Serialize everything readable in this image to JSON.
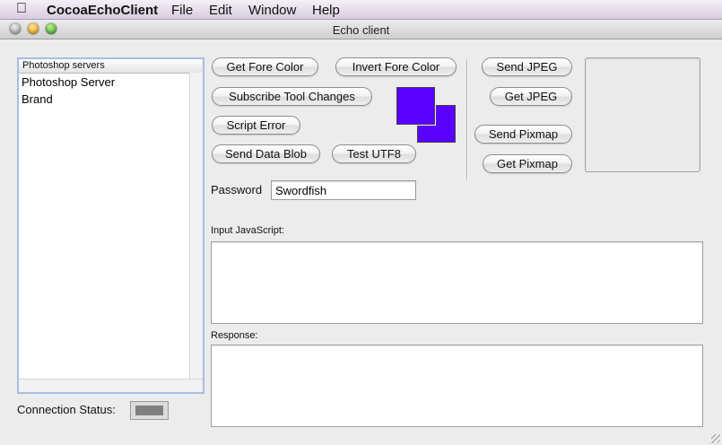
{
  "menubar": {
    "app_name": "CocoaEchoClient",
    "items": [
      "File",
      "Edit",
      "Window",
      "Help"
    ]
  },
  "window": {
    "title": "Echo client"
  },
  "server_list": {
    "header": "Photoshop servers",
    "rows": [
      "Photoshop Server",
      "Brand"
    ]
  },
  "connection": {
    "label": "Connection Status:",
    "indicator_color": "#7f7f7f"
  },
  "buttons": {
    "get_fore_color": "Get Fore Color",
    "invert_fore_color": "Invert Fore Color",
    "subscribe_tool_changes": "Subscribe Tool Changes",
    "script_error": "Script Error",
    "send_data_blob": "Send Data Blob",
    "test_utf8": "Test UTF8",
    "send_jpeg": "Send JPEG",
    "get_jpeg": "Get JPEG",
    "send_pixmap": "Send Pixmap",
    "get_pixmap": "Get Pixmap"
  },
  "colors": {
    "fore": "#5a00ff",
    "back": "#5a00ff"
  },
  "password": {
    "label": "Password",
    "value": "Swordfish"
  },
  "input_js": {
    "label": "Input JavaScript:",
    "value": ""
  },
  "response": {
    "label": "Response:",
    "value": ""
  }
}
